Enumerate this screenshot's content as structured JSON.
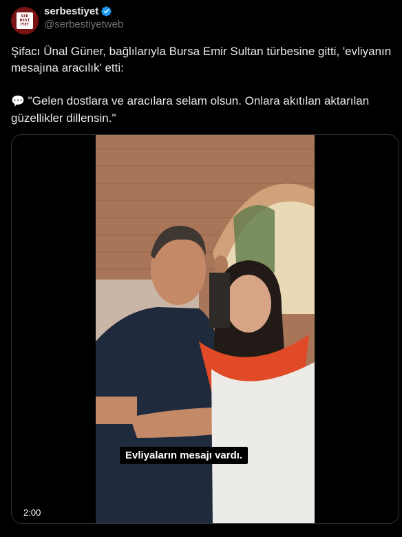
{
  "author": {
    "display_name": "serbestiyet",
    "handle": "@serbestiyetweb",
    "avatar_text": [
      "SER",
      "BEST",
      "İYET"
    ]
  },
  "tweet": {
    "line1": "Şifacı Ünal Güner, bağlılarıyla Bursa Emir Sultan türbesine gitti, 'evliyanın mesajına aracılık' etti:",
    "quote_emoji": "💬",
    "quote": "\"Gelen dostlara ve aracılara selam olsun. Onlara akıtılan aktarılan güzellikler dillensin.\""
  },
  "video": {
    "subtitle": "Evliyaların mesajı vardı.",
    "duration": "2:00"
  },
  "colors": {
    "background": "#000000",
    "text": "#e7e9ea",
    "secondary": "#71767b",
    "verified": "#1d9bf0",
    "avatar_bg": "#7a1414"
  },
  "icons": [
    "verified-badge-icon",
    "speech-bubble-icon"
  ]
}
